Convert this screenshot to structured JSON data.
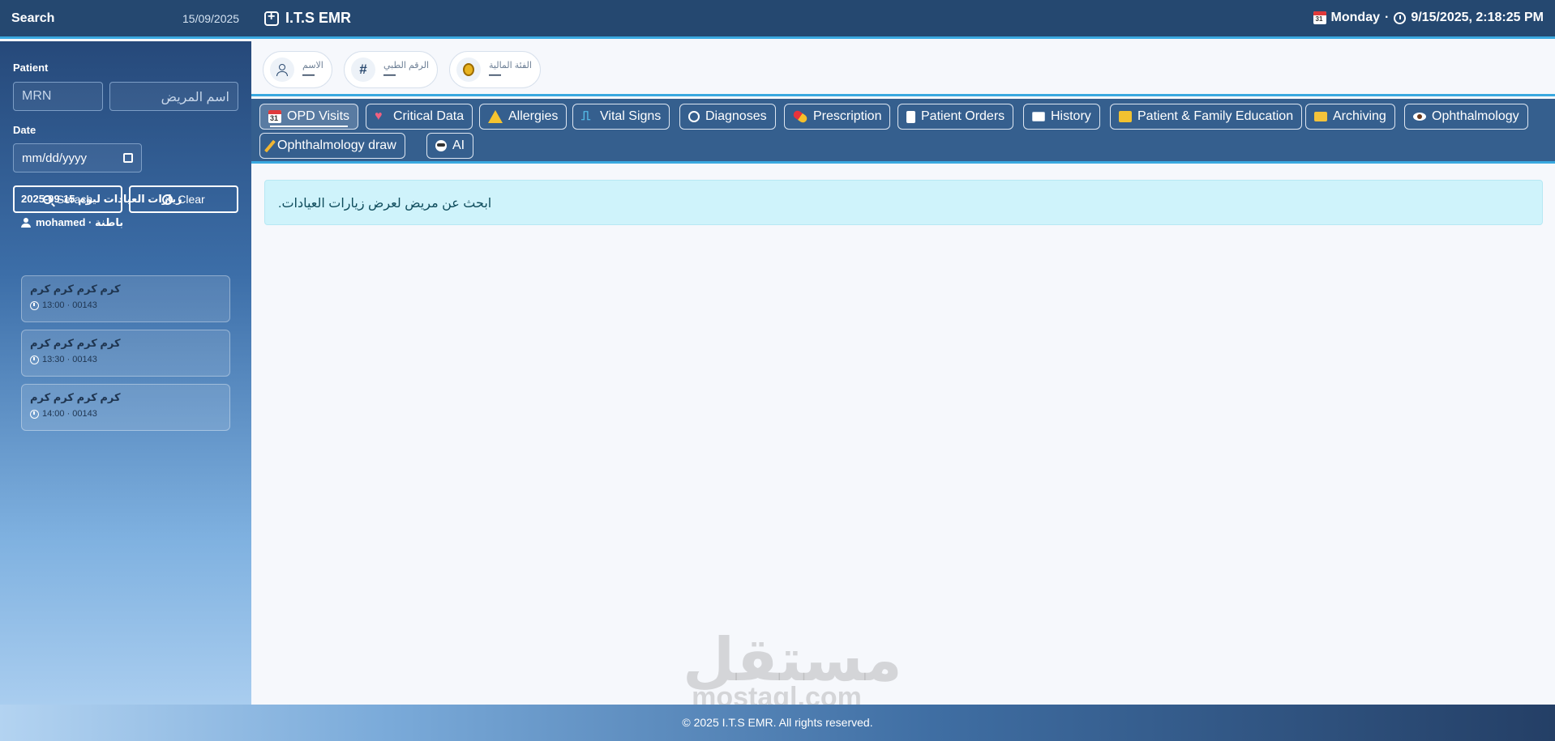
{
  "topbar": {
    "search_label": "Search",
    "date": "15/09/2025",
    "brand": "I.T.S EMR",
    "day": "Monday",
    "separator": "·",
    "datetime": "9/15/2025, 2:18:25 PM",
    "calendar_day": "31"
  },
  "sidebar": {
    "patient_label": "Patient",
    "mrn_placeholder": "MRN",
    "name_placeholder": "اسم المريض",
    "date_label": "Date",
    "date_placeholder": "mm/dd/yyyy",
    "search_button": "Serach",
    "clear_button": "Clear",
    "visits_title": "زيارات العيادات ليوم 15-09-2025",
    "doctor": "mohamed · باطنة",
    "visits": [
      {
        "name": "كرم كرم كرم كرم",
        "meta": "13:00 · 00143"
      },
      {
        "name": "كرم كرم كرم كرم",
        "meta": "13:30 · 00143"
      },
      {
        "name": "كرم كرم كرم كرم",
        "meta": "14:00 · 00143"
      }
    ]
  },
  "patient_info": {
    "name_label": "الاسم",
    "name_value": "—",
    "mrn_label": "الرقم الطبي",
    "mrn_value": "—",
    "class_label": "الفئة المالية",
    "class_value": "—"
  },
  "tabs": [
    {
      "label": "OPD Visits",
      "icon": "calendar-icon",
      "active": true
    },
    {
      "label": "Critical Data",
      "icon": "heart-icon"
    },
    {
      "label": "Allergies",
      "icon": "warning-icon"
    },
    {
      "label": "Vital Signs",
      "icon": "pulse-icon"
    },
    {
      "label": "Diagnoses",
      "icon": "stethoscope-icon"
    },
    {
      "label": "Prescription",
      "icon": "pill-icon"
    },
    {
      "label": "Patient Orders",
      "icon": "scroll-icon"
    },
    {
      "label": "History",
      "icon": "book-icon"
    },
    {
      "label": "Patient & Family Education",
      "icon": "education-icon"
    },
    {
      "label": "Archiving",
      "icon": "folder-icon"
    },
    {
      "label": "Ophthalmology",
      "icon": "eye-icon"
    },
    {
      "label": "Ophthalmology draw",
      "icon": "pencil-icon"
    },
    {
      "label": "AI",
      "icon": "ai-icon"
    }
  ],
  "alert_text": "ابحث عن مريض لعرض زيارات العيادات.",
  "watermark": {
    "arabic": "مستقل",
    "english": "mostaql.com"
  },
  "footer": "© 2025 I.T.S EMR. All rights reserved.",
  "colors": {
    "accent": "#3aa9e0",
    "topbar": "#254870",
    "tabs_bar": "#355f8e",
    "alert_bg": "#cff3fb"
  }
}
